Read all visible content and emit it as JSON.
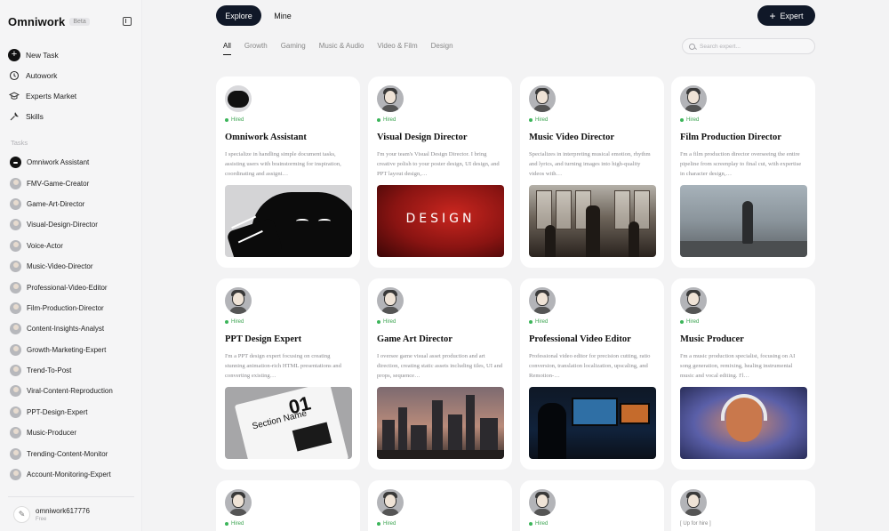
{
  "app": {
    "name": "Omniwork",
    "badge": "Beta"
  },
  "nav": [
    {
      "label": "New Task",
      "icon": "plus-icon"
    },
    {
      "label": "Autowork",
      "icon": "autowork-icon"
    },
    {
      "label": "Experts Market",
      "icon": "graduation-cap-icon"
    },
    {
      "label": "Skills",
      "icon": "wrench-icon"
    }
  ],
  "tasks_label": "Tasks",
  "tasks": [
    "Omniwork Assistant",
    "FMV-Game-Creator",
    "Game-Art-Director",
    "Visual-Design-Director",
    "Voice-Actor",
    "Music-Video-Director",
    "Professional-Video-Editor",
    "Film-Production-Director",
    "Content-Insights-Analyst",
    "Growth-Marketing-Expert",
    "Trend-To-Post",
    "Viral-Content-Reproduction",
    "PPT-Design-Expert",
    "Music-Producer",
    "Trending-Content-Monitor",
    "Account-Monitoring-Expert"
  ],
  "user": {
    "name": "omniwork617776",
    "plan": "Free"
  },
  "topbar": {
    "explore": "Explore",
    "mine": "Mine",
    "expert_button": "Expert"
  },
  "filters": [
    "All",
    "Growth",
    "Gaming",
    "Music & Audio",
    "Video & Film",
    "Design"
  ],
  "search": {
    "placeholder": "Search expert..."
  },
  "cards": [
    {
      "title": "Omniwork Assistant",
      "status": "Hired",
      "desc": "I specialize in handling simple document tasks, assisting users with brainstorming for inspiration, coordinating and assigni…"
    },
    {
      "title": "Visual Design Director",
      "status": "Hired",
      "desc": "I'm your team's Visual Design Director. I bring creative polish to your poster design, UI design, and PPT layout design,…",
      "image_text": "DESIGN"
    },
    {
      "title": "Music Video Director",
      "status": "Hired",
      "desc": "Specializes in interpreting musical emotion, rhythm and lyrics, and turning images into high-quality videos with…"
    },
    {
      "title": "Film Production Director",
      "status": "Hired",
      "desc": "I'm a film production director overseeing the entire pipeline from screenplay to final cut, with expertise in character design,…"
    },
    {
      "title": "PPT Design Expert",
      "status": "Hired",
      "desc": "I'm a PPT design expert focusing on creating stunning animation-rich HTML presentations and converting existing…",
      "image_num": "01",
      "image_text": "Section Name"
    },
    {
      "title": "Game Art Director",
      "status": "Hired",
      "desc": "I oversee game visual asset production and art direction, creating static assets including tiles, UI and props, sequence…"
    },
    {
      "title": "Professional Video Editor",
      "status": "Hired",
      "desc": "Professional video editor for precision cutting, ratio conversion, translation localization, upscaling, and Remotion-…"
    },
    {
      "title": "Music Producer",
      "status": "Hired",
      "desc": "I'm a music production specialist, focusing on AI song generation, remixing, healing instrumental music and vocal editing. I'l…"
    },
    {
      "status": "Hired"
    },
    {
      "status": "Hired"
    },
    {
      "status": "Hired"
    },
    {
      "status": "[ Up for hire ]"
    }
  ]
}
